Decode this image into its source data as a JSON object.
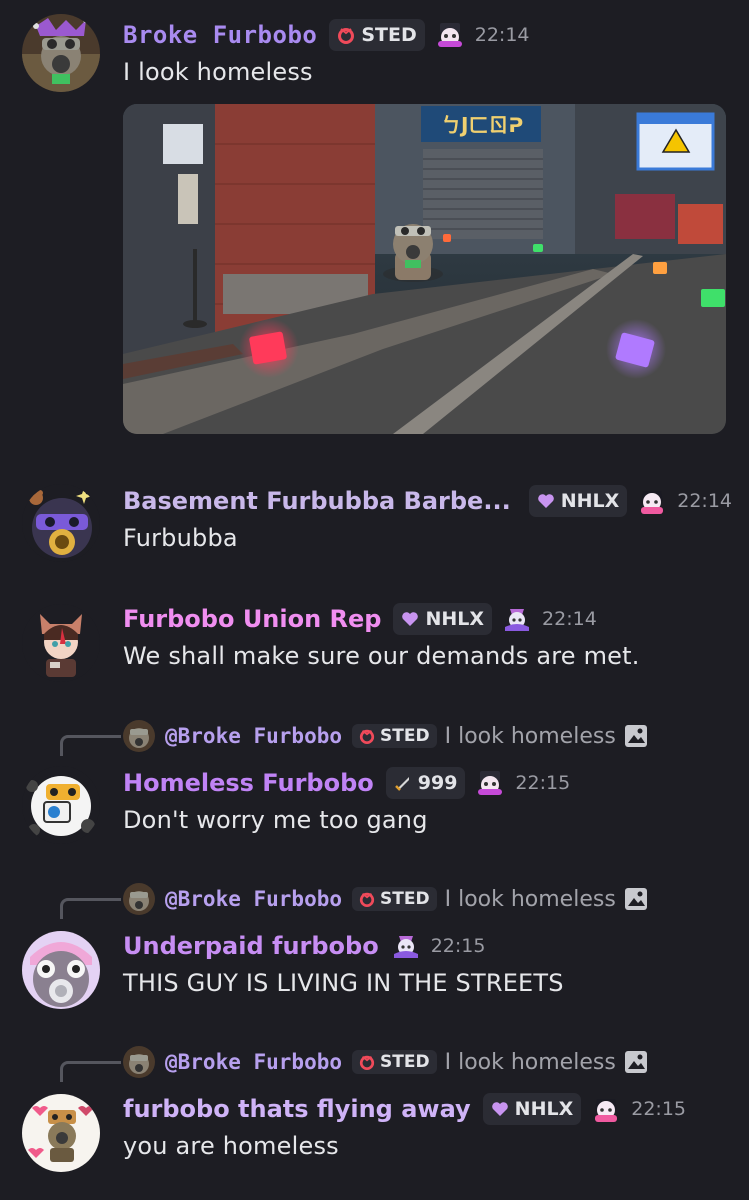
{
  "colors": {
    "background": "#1d1d23",
    "name_purple": "#a98bf0",
    "name_lilac": "#c9b8ea",
    "name_pink": "#f08ef0",
    "name_violet": "#c083f5",
    "name_magenta": "#c78ef3",
    "name_lavender": "#cfb3f7",
    "timestamp": "#9a9ba3",
    "tag_bg": "#2b2c34"
  },
  "messages": [
    {
      "author": "Broke Furbobo",
      "tag": "STED",
      "time": "22:14",
      "text": "I look homeless",
      "has_image": true
    },
    {
      "author": "Basement Furbubba Barbe...",
      "tag": "NHLX",
      "time": "22:14",
      "text": "Furbubba"
    },
    {
      "author": "Furbobo Union Rep",
      "tag": "NHLX",
      "time": "22:14",
      "text": "We shall make sure our demands are met."
    },
    {
      "reply": {
        "author": "@Broke Furbobo",
        "tag": "STED",
        "text": "I look homeless"
      },
      "author": "Homeless Furbobo",
      "tag": "999",
      "time": "22:15",
      "text": "Don't worry me too gang"
    },
    {
      "reply": {
        "author": "@Broke Furbobo",
        "tag": "STED",
        "text": "I look homeless"
      },
      "author": "Underpaid furbobo",
      "time": "22:15",
      "text": "THIS GUY IS LIVING IN THE STREETS"
    },
    {
      "reply": {
        "author": "@Broke Furbobo",
        "tag": "STED",
        "text": "I look homeless"
      },
      "author": "furbobo thats flying away",
      "tag": "NHLX",
      "time": "22:15",
      "text": "you are homeless"
    }
  ],
  "icons": {
    "sted_tag": "red-ring-icon",
    "nhlx_tag": "purple-heart-icon",
    "rank_tag": "sword-icon",
    "attachment": "image-icon"
  }
}
